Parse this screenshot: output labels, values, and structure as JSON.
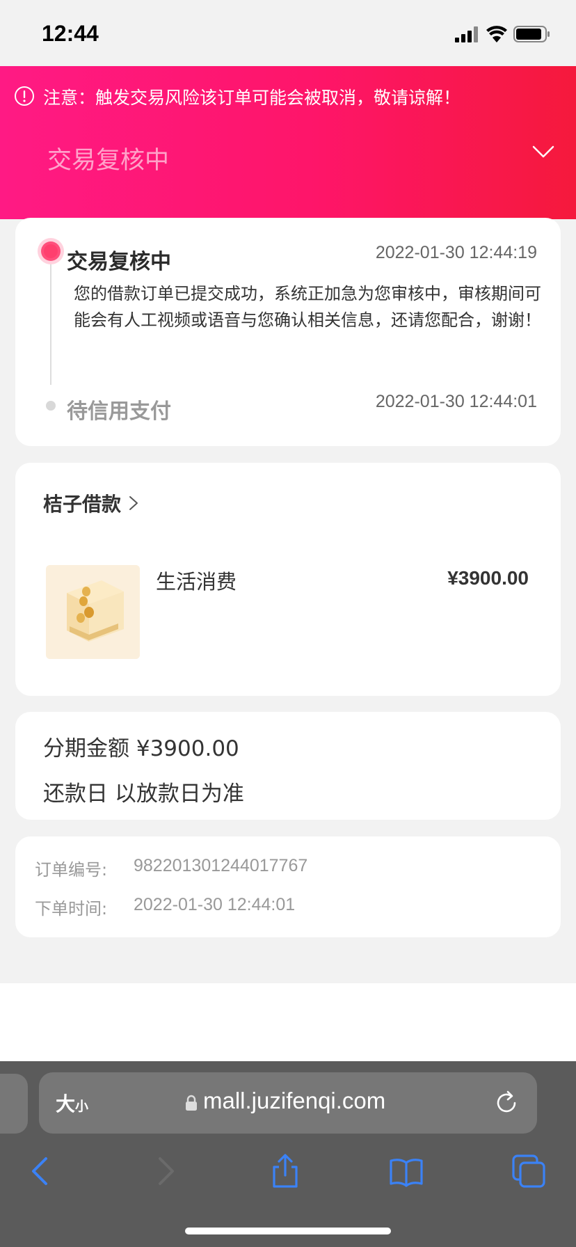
{
  "status_bar": {
    "time": "12:44"
  },
  "header": {
    "notice": "注意：触发交易风险该订单可能会被取消，敬请谅解！",
    "status_title": "交易复核中"
  },
  "timeline": {
    "steps": [
      {
        "title": "交易复核中",
        "time": "2022-01-30 12:44:19",
        "description": "您的借款订单已提交成功，系统正加急为您审核中，审核期间可能会有人工视频或语音与您确认相关信息，还请您配合，谢谢！",
        "active": true
      },
      {
        "title": "待信用支付",
        "time": "2022-01-30 12:44:01",
        "active": false
      }
    ]
  },
  "product": {
    "store_name": "桔子借款",
    "name": "生活消费",
    "price": "¥3900.00"
  },
  "amount": {
    "installment": "分期金额 ¥3900.00",
    "repayment_day": "还款日 以放款日为准"
  },
  "order": {
    "number_label": "订单编号:",
    "number_value": "982201301244017767",
    "time_label": "下单时间:",
    "time_value": "2022-01-30 12:44:01"
  },
  "browser": {
    "size_label_large": "大",
    "size_label_small": "小",
    "url": "mall.juzifenqi.com"
  },
  "colors": {
    "header_gradient_start": "#ff1a84",
    "header_gradient_end": "#f5193c",
    "timeline_active": "#ff3f6e",
    "browser_bar": "#5b5b5b",
    "toolbar_accent": "#3b82f6"
  },
  "icons": [
    "signal-icon",
    "wifi-icon",
    "battery-icon",
    "exclamation-circle-icon",
    "chevron-down-icon",
    "chevron-right-icon",
    "lock-icon",
    "reload-icon",
    "back-icon",
    "forward-icon",
    "share-icon",
    "bookmarks-icon",
    "tabs-icon"
  ]
}
